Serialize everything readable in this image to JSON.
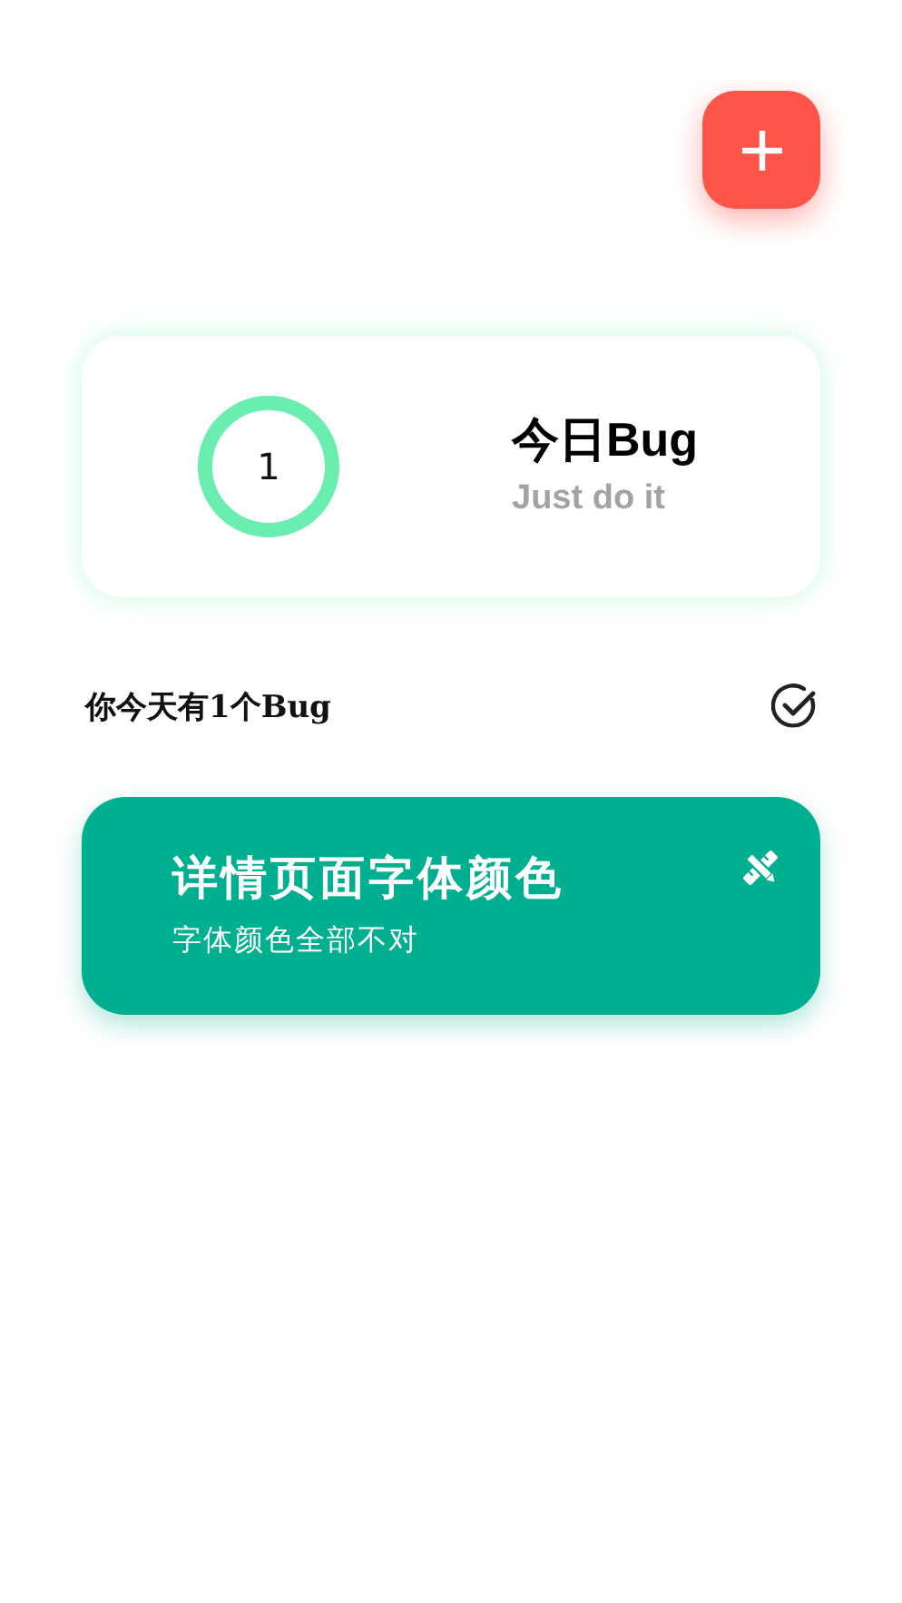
{
  "summary": {
    "count": "1",
    "title": "今日Bug",
    "subtitle": "Just do it"
  },
  "status_line": "你今天有1个Bug",
  "bugs": [
    {
      "title": "详情页面字体颜色",
      "description": "字体颜色全部不对"
    }
  ]
}
